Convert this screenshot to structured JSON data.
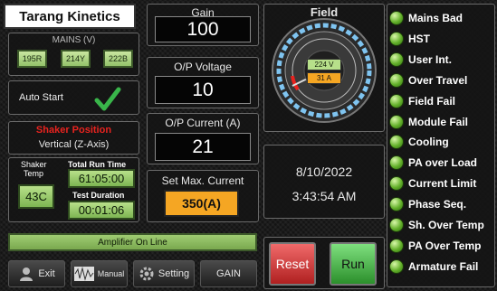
{
  "logo": "Tarang Kinetics",
  "mains": {
    "title": "MAINS (V)",
    "values": [
      "195R",
      "214Y",
      "222B"
    ]
  },
  "auto_start": {
    "label": "Auto Start"
  },
  "shaker_position": {
    "title": "Shaker Position",
    "value": "Vertical (Z-Axis)"
  },
  "shaker_temp": {
    "label_line1": "Shaker",
    "label_line2": "Temp",
    "value": "43C"
  },
  "run_time": {
    "label": "Total Run Time",
    "value": "61:05:00"
  },
  "test_duration": {
    "label": "Test Duration",
    "value": "00:01:06"
  },
  "status_bar": "Amplifier On Line",
  "gain": {
    "label": "Gain",
    "value": "100"
  },
  "op_voltage": {
    "label": "O/P Voltage",
    "value": "10"
  },
  "op_current": {
    "label": "O/P Current (A)",
    "value": "21"
  },
  "max_current": {
    "label": "Set Max. Current",
    "value": "350(A)"
  },
  "field": {
    "label": "Field",
    "voltage": "224 V",
    "current": "31 A"
  },
  "datetime": {
    "date": "8/10/2022",
    "time": "3:43:54 AM"
  },
  "buttons": {
    "reset": "Reset",
    "run": "Run"
  },
  "nav": {
    "exit": "Exit",
    "manual": "Manual",
    "setting": "Setting",
    "gain": "GAIN"
  },
  "alarms": [
    "Mains Bad",
    "HST",
    "User Int.",
    "Over Travel",
    "Field Fail",
    "Module Fail",
    "Cooling",
    "PA over Load",
    "Current Limit",
    "Phase Seq.",
    "Sh. Over Temp",
    "PA Over Temp",
    "Armature Fail"
  ],
  "colors": {
    "accent_green": "#93c26a",
    "alarm_red": "#e8231f",
    "max_current_orange": "#f5a623",
    "reset_red": "#d23a3a",
    "run_green": "#3fae3f",
    "led_green": "#63b02a"
  }
}
